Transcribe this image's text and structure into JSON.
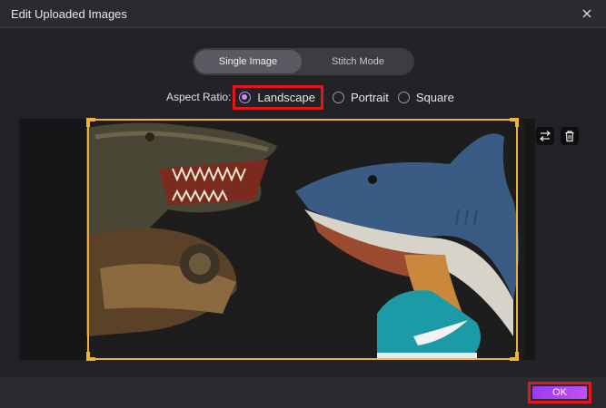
{
  "window": {
    "title": "Edit Uploaded Images",
    "close_icon": "close-icon"
  },
  "mode_toggle": {
    "options": [
      "Single Image",
      "Stitch Mode"
    ],
    "selected": "Single Image"
  },
  "aspect_ratio": {
    "label": "Aspect Ratio:",
    "options": [
      "Landscape",
      "Portrait",
      "Square"
    ],
    "selected": "Landscape"
  },
  "tools": {
    "swap_icon": "swap-icon",
    "delete_icon": "delete-icon"
  },
  "footer": {
    "ok_label": "OK"
  },
  "colors": {
    "accent": "#c68cf7",
    "crop_frame": "#f0b33a",
    "highlight": "#e3161b",
    "ok_gradient_start": "#9b3cf0",
    "ok_gradient_end": "#c250f5"
  }
}
